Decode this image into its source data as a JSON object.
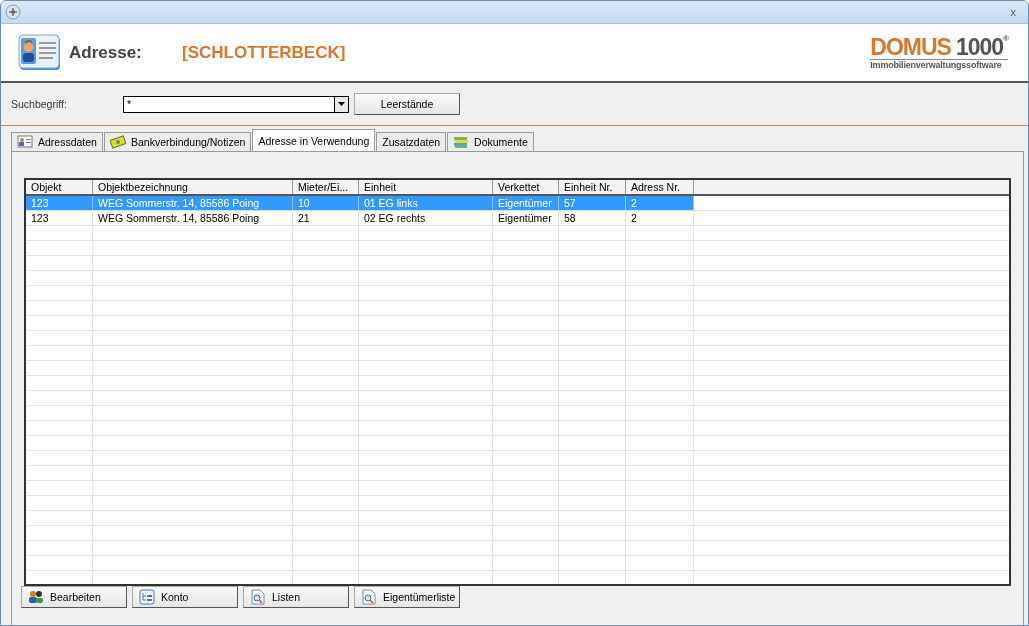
{
  "window": {
    "close": "x"
  },
  "header": {
    "label": "Adresse:",
    "name": "[SCHLOTTERBECK]",
    "logo": {
      "brand": "DOMUS",
      "number": "1000",
      "mark": "®",
      "tagline": "Immobilienverwaltungssoftware"
    }
  },
  "search": {
    "label": "Suchbegriff:",
    "value": "*",
    "button": "Leerstände"
  },
  "tabs": [
    {
      "label": "Adressdaten",
      "selected": false
    },
    {
      "label": "Bankverbindung/Notizen",
      "selected": false
    },
    {
      "label": "Adresse in Verwendung",
      "selected": true
    },
    {
      "label": "Zusatzdaten",
      "selected": false
    },
    {
      "label": "Dokumente",
      "selected": false
    }
  ],
  "table": {
    "columns": [
      "Objekt",
      "Objektbezeichnung",
      "Mieter/Ei...",
      "Einheit",
      "Verkettet",
      "Einheit Nr.",
      "Adress Nr."
    ],
    "rows": [
      {
        "selected": true,
        "cells": [
          "123",
          "WEG Sommerstr. 14, 85586 Poing",
          "10",
          "01 EG links",
          "Eigentümer",
          "57",
          "2"
        ]
      },
      {
        "selected": false,
        "cells": [
          "123",
          "WEG Sommerstr. 14, 85586 Poing",
          "21",
          "02 EG rechts",
          "Eigentümer",
          "58",
          "2"
        ]
      }
    ]
  },
  "buttons": [
    {
      "label": "Bearbeiten"
    },
    {
      "label": "Konto"
    },
    {
      "label": "Listen"
    },
    {
      "label": "Eigentümerliste"
    }
  ]
}
